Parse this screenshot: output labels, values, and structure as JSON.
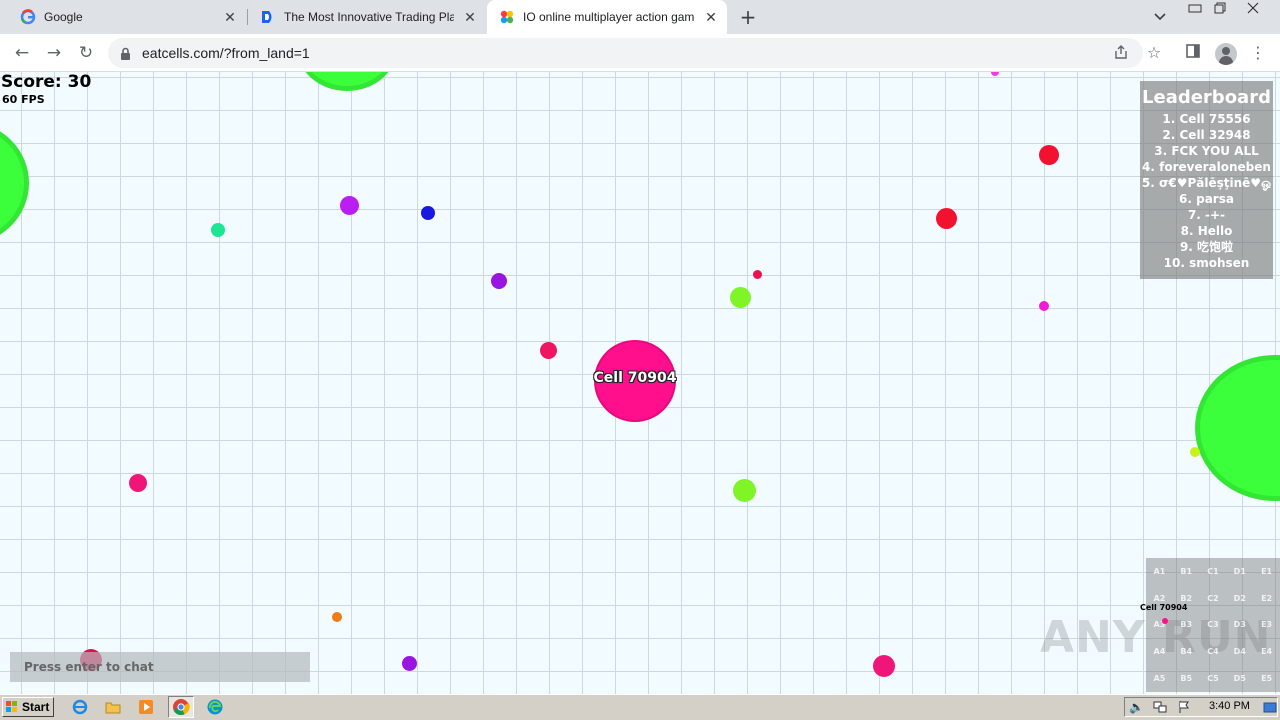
{
  "browser": {
    "tabs": [
      {
        "title": "Google",
        "active": false
      },
      {
        "title": "The Most Innovative Trading Platform",
        "active": false
      },
      {
        "title": "IO online multiplayer action game. Sl",
        "active": true
      }
    ],
    "url": "eatcells.com/?from_land=1"
  },
  "game": {
    "score_label": "Score: 30",
    "fps_label": "60 FPS",
    "player_name": "Cell 70904",
    "player_color": "#ff0f8c",
    "leaderboard": {
      "title": "Leaderboard",
      "entries": [
        "1. Cell 75556",
        "2. Cell 32948",
        "3. FCK YOU ALL",
        "4. foreveraloneben",
        "5. σ€♥Pălēşţinē♥ஓ",
        "6. parsa",
        "7. -+-",
        "8. Hello",
        "9. 吃饱啦",
        "10. smohsen"
      ]
    },
    "minimap": {
      "labels": [
        "A1",
        "B1",
        "C1",
        "D1",
        "E1",
        "A2",
        "B2",
        "C2",
        "D2",
        "E2",
        "A3",
        "B3",
        "C3",
        "D3",
        "E3",
        "A4",
        "B4",
        "C4",
        "D4",
        "E4",
        "A5",
        "B5",
        "C5",
        "D5",
        "E5"
      ],
      "player_label": "Cell 70904"
    },
    "chat_placeholder": "Press enter to chat",
    "watermark": "ANY RUN"
  },
  "taskbar": {
    "start_label": "Start",
    "clock": "3:40 PM"
  }
}
